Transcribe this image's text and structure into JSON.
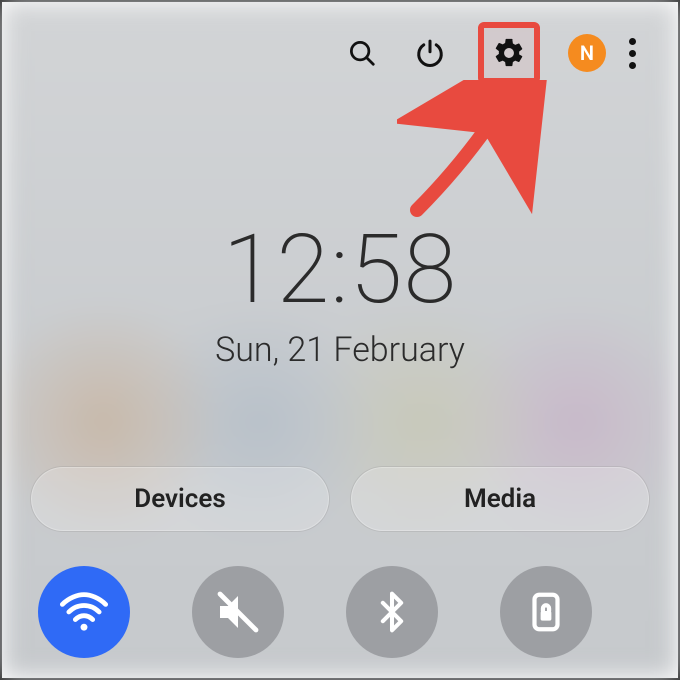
{
  "colors": {
    "highlight": "#e84a3f",
    "avatar_bg": "#f58b1f",
    "toggle_active": "#2f6af6",
    "toggle_inactive": "#9d9fa3"
  },
  "topbar": {
    "avatar_initial": "N"
  },
  "clock": {
    "time": "12:58",
    "date": "Sun, 21 February"
  },
  "segments": {
    "devices": "Devices",
    "media": "Media"
  },
  "toggles": {
    "wifi": {
      "active": true
    },
    "mute": {
      "active": false
    },
    "bluetooth": {
      "active": false
    },
    "rotation_lock": {
      "active": false
    }
  }
}
